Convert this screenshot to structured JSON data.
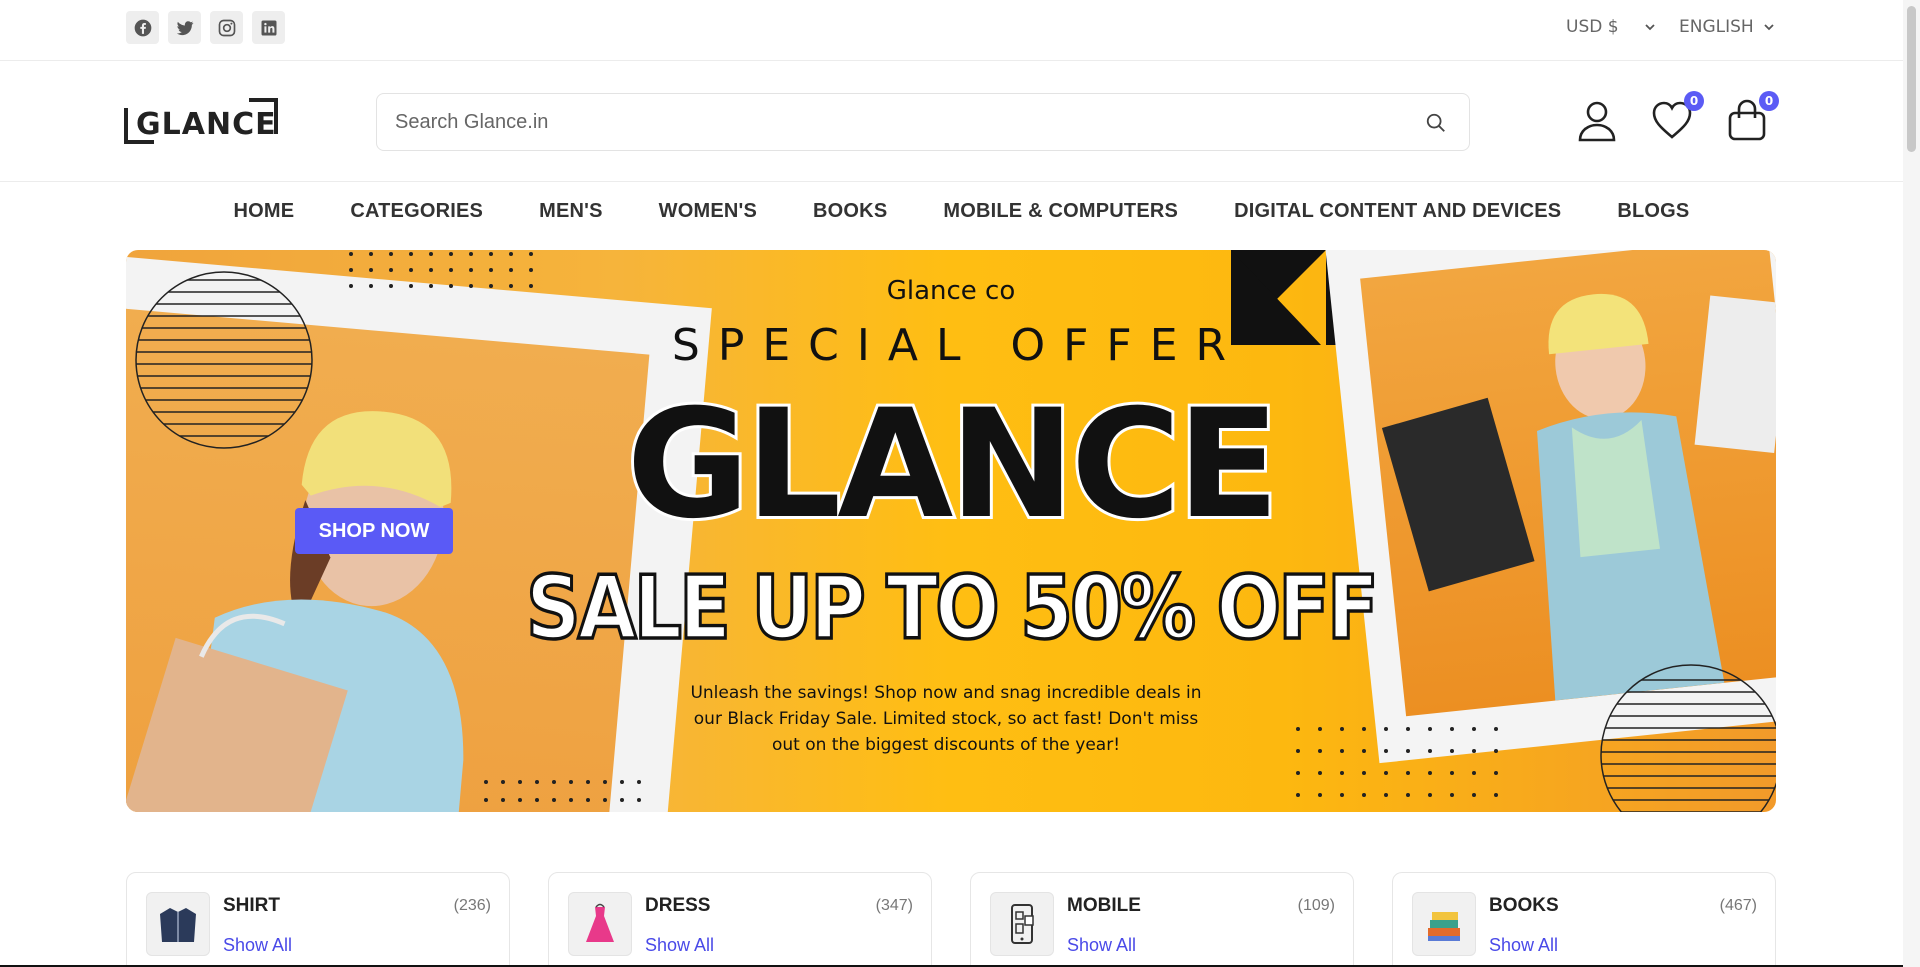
{
  "social": [
    "facebook-icon",
    "twitter-icon",
    "instagram-icon",
    "linkedin-icon"
  ],
  "topbar": {
    "currency": "USD $",
    "language": "ENGLISH"
  },
  "header": {
    "logo": "GLANCE",
    "search_placeholder": "Search Glance.in",
    "wishlist_count": "0",
    "cart_count": "0"
  },
  "nav": [
    "HOME",
    "CATEGORIES",
    "MEN'S",
    "WOMEN'S",
    "BOOKS",
    "MOBILE & COMPUTERS",
    "DIGITAL CONTENT AND DEVICES",
    "BLOGS"
  ],
  "banner": {
    "brand": "Glance co",
    "special": "SPECIAL OFFER",
    "headline": "GLANCE",
    "sale": "SALE UP TO 50% OFF",
    "description": "Unleash the savings! Shop now and snag incredible deals in our Black Friday Sale. Limited stock, so act fast! Don't miss out on the biggest discounts of the year!",
    "cta": "SHOP NOW"
  },
  "categories": [
    {
      "name": "SHIRT",
      "count": "(236)",
      "link": "Show All",
      "icon": "jacket-icon"
    },
    {
      "name": "DRESS",
      "count": "(347)",
      "link": "Show All",
      "icon": "dress-icon"
    },
    {
      "name": "MOBILE",
      "count": "(109)",
      "link": "Show All",
      "icon": "phone-icon"
    },
    {
      "name": "BOOKS",
      "count": "(467)",
      "link": "Show All",
      "icon": "books-icon"
    }
  ],
  "colors": {
    "accent": "#5b5bf5",
    "banner_yellow": "#ffbe12",
    "banner_orange": "#f0a43c"
  }
}
